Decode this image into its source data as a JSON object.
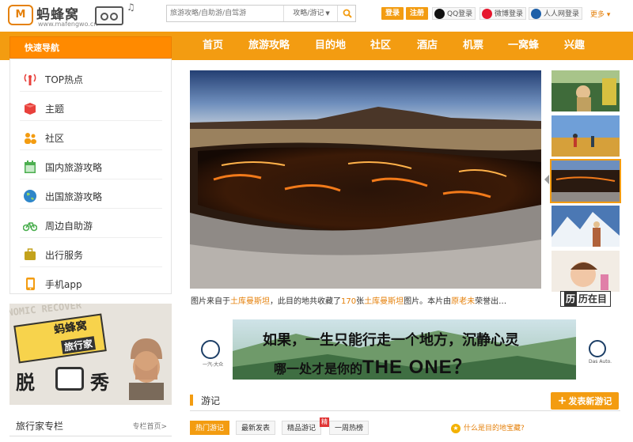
{
  "header": {
    "logo_text": "蚂蜂窝",
    "logo_mark": "M",
    "logo_url": "www.mafengwo.cn",
    "search": {
      "placeholder": "旅游攻略/自助游/自驾游",
      "type_label": "攻略/游记"
    },
    "login_label": "登录",
    "register_label": "注册",
    "qq_login": "QQ登录",
    "weibo_login": "微博登录",
    "renren_login": "人人网登录",
    "more_label": "更多"
  },
  "nav": {
    "quick_label": "快速导航",
    "items": [
      "首页",
      "旅游攻略",
      "目的地",
      "社区",
      "酒店",
      "机票",
      "一窝蜂",
      "兴趣"
    ]
  },
  "sidebar": {
    "items": [
      {
        "label": "TOP热点",
        "icon": "signal-icon",
        "color": "#e8413c"
      },
      {
        "label": "主题",
        "icon": "box-icon",
        "color": "#e8413c"
      },
      {
        "label": "社区",
        "icon": "people-icon",
        "color": "#f39c11"
      },
      {
        "label": "国内旅游攻略",
        "icon": "calendar-icon",
        "color": "#4caf50"
      },
      {
        "label": "出国旅游攻略",
        "icon": "globe-icon",
        "color": "#2e86c9"
      },
      {
        "label": "周边自助游",
        "icon": "bike-icon",
        "color": "#4caf50"
      },
      {
        "label": "出行服务",
        "icon": "suitcase-icon",
        "color": "#c3a21c"
      },
      {
        "label": "手机app",
        "icon": "phone-icon",
        "color": "#f39c11"
      }
    ]
  },
  "promo": {
    "bg_text": "ONOMIC RECOVER",
    "brand": "蚂蜂窝",
    "sub": "旅行家",
    "big_left": "脱",
    "big_right": "秀"
  },
  "column": {
    "title": "旅行家专栏",
    "link": "专栏首页>"
  },
  "hero": {
    "caption_prefix": "图片来自于",
    "caption_place": "土库曼斯坦",
    "caption_mid": "，此目的地共收藏了",
    "caption_count": "170",
    "caption_mid2": "张",
    "caption_place2": "土库曼斯坦",
    "caption_mid3": "图片。本片由",
    "caption_author": "原老未",
    "caption_tail": "荣誉出…",
    "history_char": "历",
    "history_rest": "历在目"
  },
  "ad": {
    "line1": "如果，一生只能行走一个地方，沉静心灵",
    "line2_prefix": "哪一处才是你的",
    "line2_big": "THE ONE？",
    "left_brand": "一汽-大众",
    "right_brand": "Das Auto."
  },
  "notes": {
    "title": "游记",
    "write_label": "发表新游记",
    "tabs": [
      "热门游记",
      "最新发表",
      "精品游记",
      "一周热榜"
    ],
    "badge": "精",
    "treasure": "什么是目的地宝藏?"
  }
}
